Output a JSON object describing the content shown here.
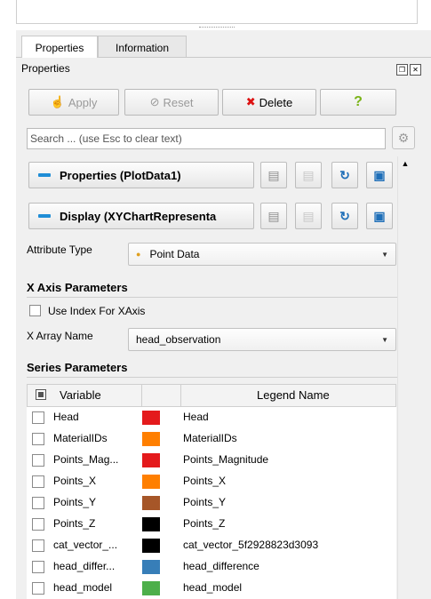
{
  "tabs": [
    {
      "label": "Properties",
      "active": true
    },
    {
      "label": "Information",
      "active": false
    }
  ],
  "panel": {
    "title": "Properties"
  },
  "actions": {
    "apply": "Apply",
    "reset": "Reset",
    "delete": "Delete",
    "help": "?"
  },
  "search": {
    "placeholder": "Search ... (use Esc to clear text)"
  },
  "sections": {
    "properties": "Properties (PlotData1)",
    "display": "Display (XYChartRepresenta"
  },
  "attribute": {
    "label": "Attribute Type",
    "value": "Point Data"
  },
  "x_axis": {
    "heading": "X Axis Parameters",
    "use_index_label": "Use Index For XAxis",
    "array_label": "X Array Name",
    "array_value": "head_observation"
  },
  "series": {
    "heading": "Series Parameters",
    "col_variable": "Variable",
    "col_legend": "Legend Name",
    "rows": [
      {
        "variable": "Head",
        "color": "#e41a1c",
        "legend": "Head"
      },
      {
        "variable": "MaterialIDs",
        "color": "#ff7f00",
        "legend": "MaterialIDs"
      },
      {
        "variable": "Points_Mag...",
        "color": "#e41a1c",
        "legend": "Points_Magnitude"
      },
      {
        "variable": "Points_X",
        "color": "#ff7f00",
        "legend": "Points_X"
      },
      {
        "variable": "Points_Y",
        "color": "#a65628",
        "legend": "Points_Y"
      },
      {
        "variable": "Points_Z",
        "color": "#000000",
        "legend": "Points_Z"
      },
      {
        "variable": "cat_vector_...",
        "color": "#000000",
        "legend": "cat_vector_5f2928823d3093"
      },
      {
        "variable": "head_differ...",
        "color": "#377eb8",
        "legend": "head_difference"
      },
      {
        "variable": "head_model",
        "color": "#4daf4a",
        "legend": "head_model"
      }
    ]
  }
}
